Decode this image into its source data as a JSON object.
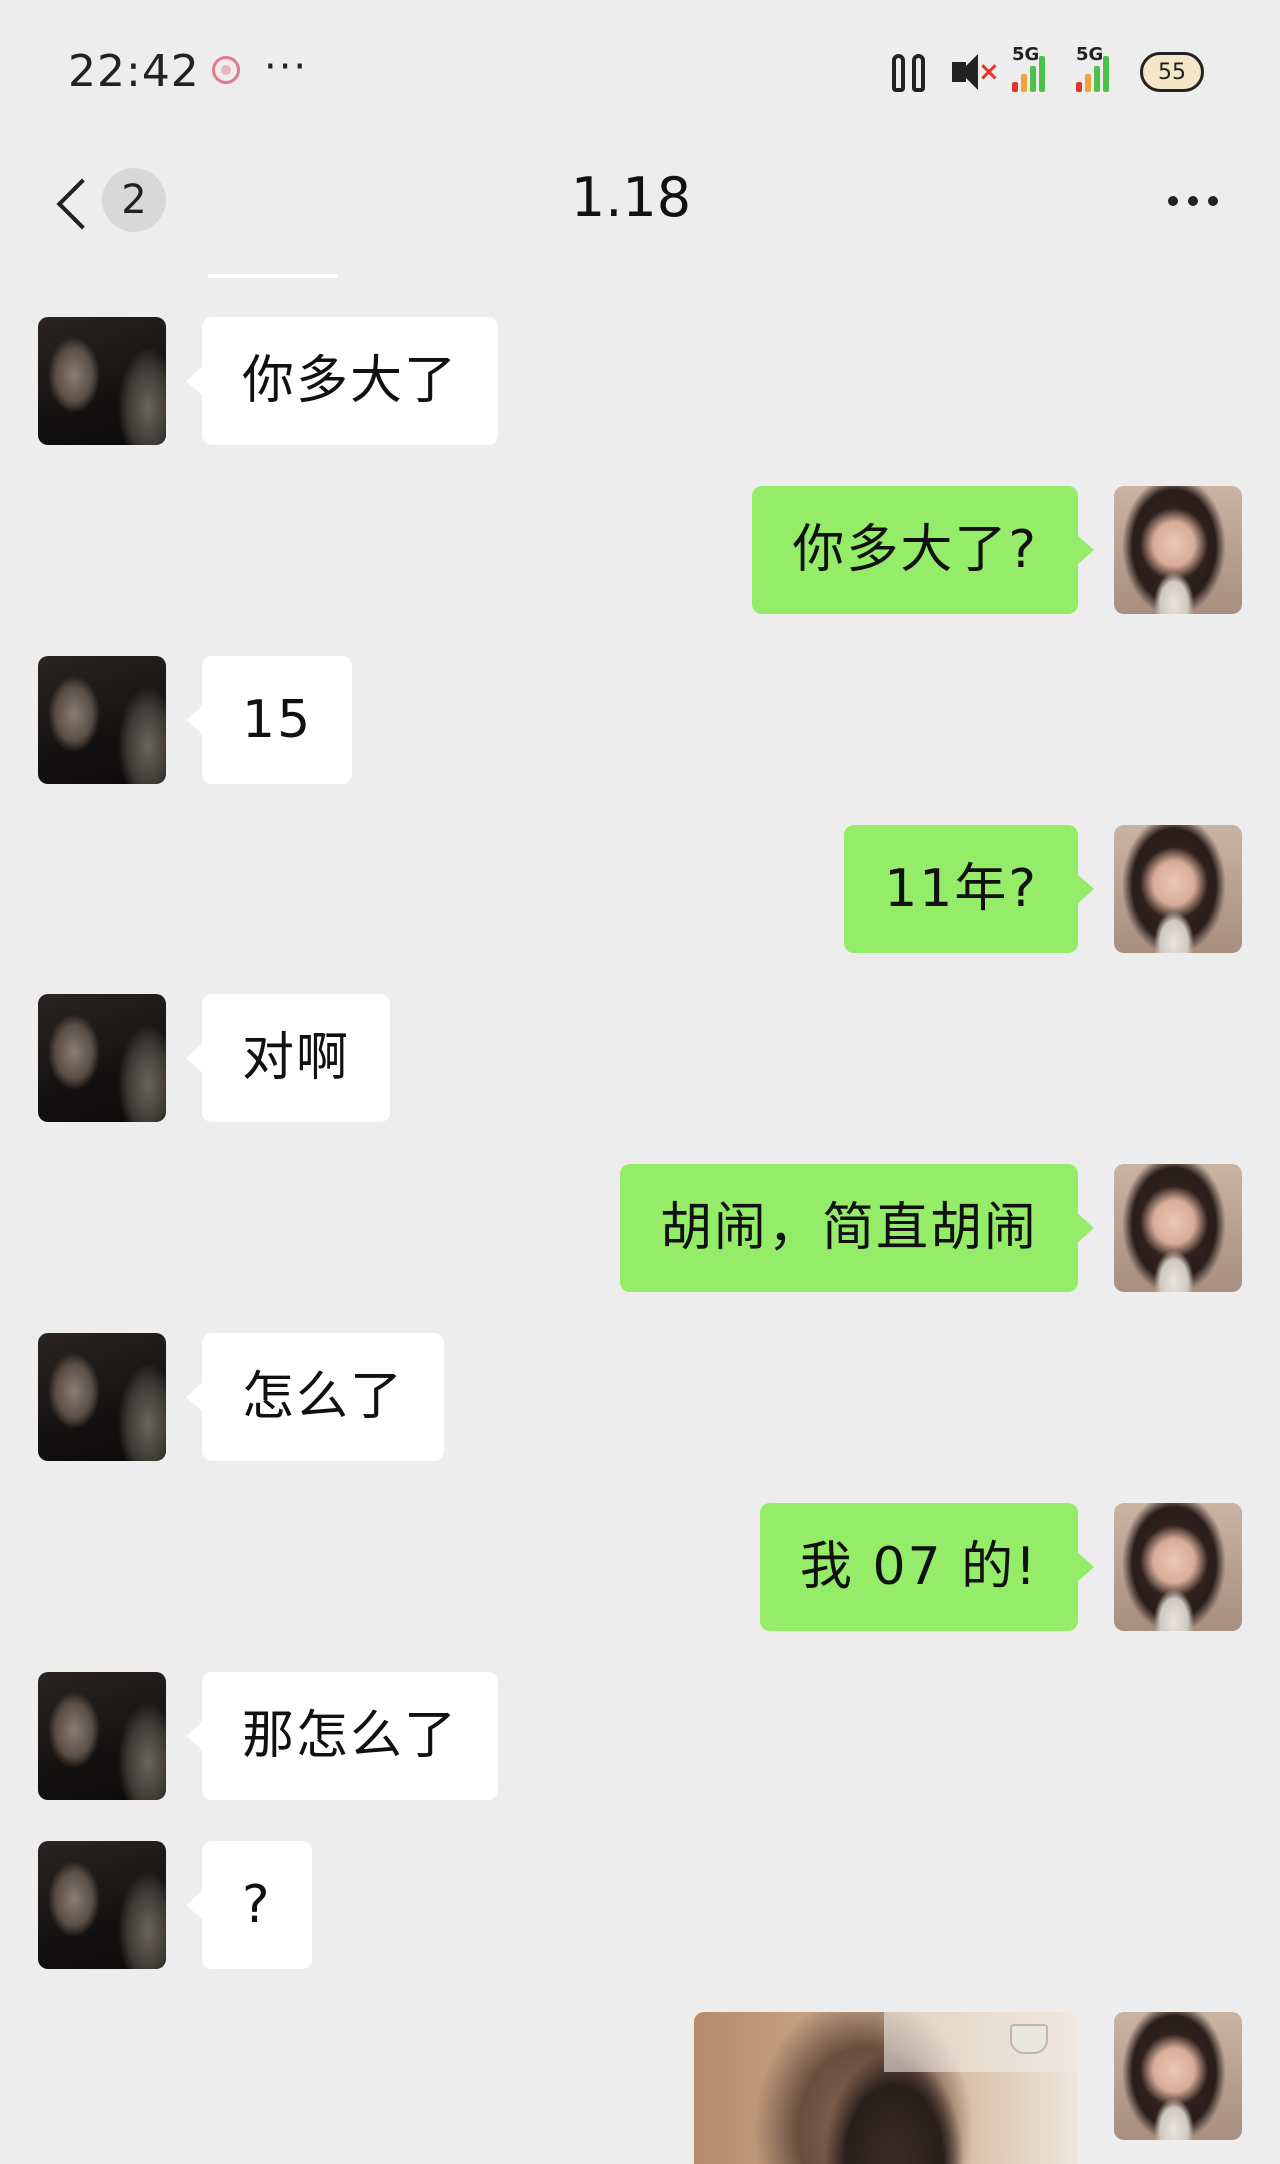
{
  "status_bar": {
    "time": "22:42",
    "more_glyph": "···",
    "icons": [
      "notification-app-icon",
      "earbuds-icon",
      "mute-icon",
      "signal-5g-icon",
      "signal-5g-icon",
      "battery-icon"
    ],
    "sim1_label": "5G",
    "sim2_label": "5G",
    "battery_level": "55"
  },
  "nav": {
    "title": "1.18",
    "unread_count": "2"
  },
  "colors": {
    "background": "#ededed",
    "incoming_bubble": "#ffffff",
    "outgoing_bubble": "#95ec69"
  },
  "messages": [
    {
      "side": "in",
      "text": "你多大了"
    },
    {
      "side": "out",
      "text": "你多大了?"
    },
    {
      "side": "in",
      "text": "15"
    },
    {
      "side": "out",
      "text": "11年?"
    },
    {
      "side": "in",
      "text": "对啊"
    },
    {
      "side": "out",
      "text": "胡闹，简直胡闹"
    },
    {
      "side": "in",
      "text": "怎么了"
    },
    {
      "side": "out",
      "text": "我 07 的!"
    },
    {
      "side": "in",
      "text": "那怎么了"
    },
    {
      "side": "in",
      "text": "?"
    },
    {
      "side": "out",
      "type": "image"
    }
  ]
}
